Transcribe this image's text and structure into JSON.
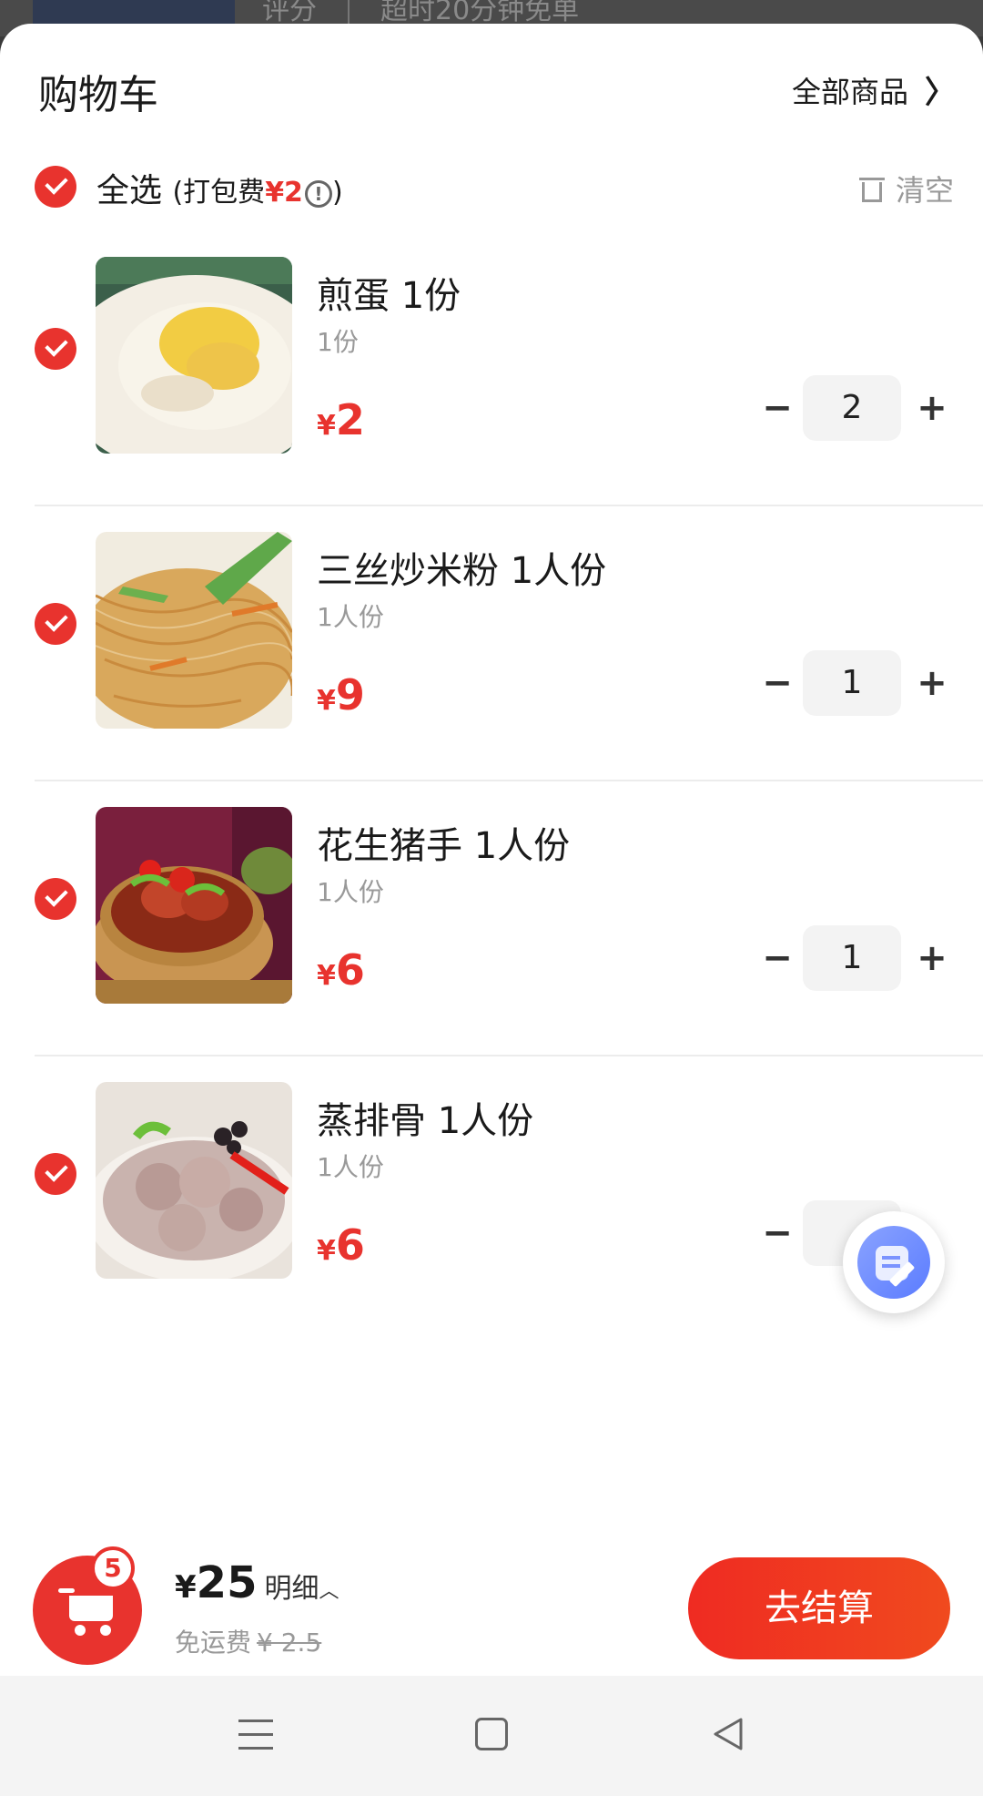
{
  "background": {
    "text_left": "评分",
    "text_right": "超时20分钟免单"
  },
  "header": {
    "title": "购物车",
    "all_goods_label": "全部商品",
    "chevron": "〉"
  },
  "select_row": {
    "select_all_label": "全选",
    "pack_fee_prefix": "(打包费",
    "pack_fee_value": "¥2",
    "pack_fee_suffix": ")",
    "info_glyph": "!",
    "clear_label": "清空"
  },
  "items": [
    {
      "name": "煎蛋 1份",
      "spec": "1份",
      "currency": "¥",
      "price": "2",
      "qty": "2"
    },
    {
      "name": "三丝炒米粉 1人份",
      "spec": "1人份",
      "currency": "¥",
      "price": "9",
      "qty": "1"
    },
    {
      "name": "花生猪手 1人份",
      "spec": "1人份",
      "currency": "¥",
      "price": "6",
      "qty": "1"
    },
    {
      "name": "蒸排骨 1人份",
      "spec": "1人份",
      "currency": "¥",
      "price": "6",
      "qty": ""
    }
  ],
  "stepper": {
    "minus": "−",
    "plus": "+"
  },
  "bottom": {
    "badge_count": "5",
    "currency": "¥",
    "total": "25",
    "detail_label": "明细",
    "detail_caret": "︿",
    "shipping_label": "免运费",
    "shipping_original": "¥ 2.5",
    "checkout_label": "去结算"
  },
  "colors": {
    "accent": "#e8332e",
    "price": "#e8332e",
    "muted": "#999999"
  },
  "icons": {
    "cart": "shopping-cart-icon",
    "trash": "trash-icon",
    "info": "info-circle-icon",
    "float": "order-note-icon"
  }
}
